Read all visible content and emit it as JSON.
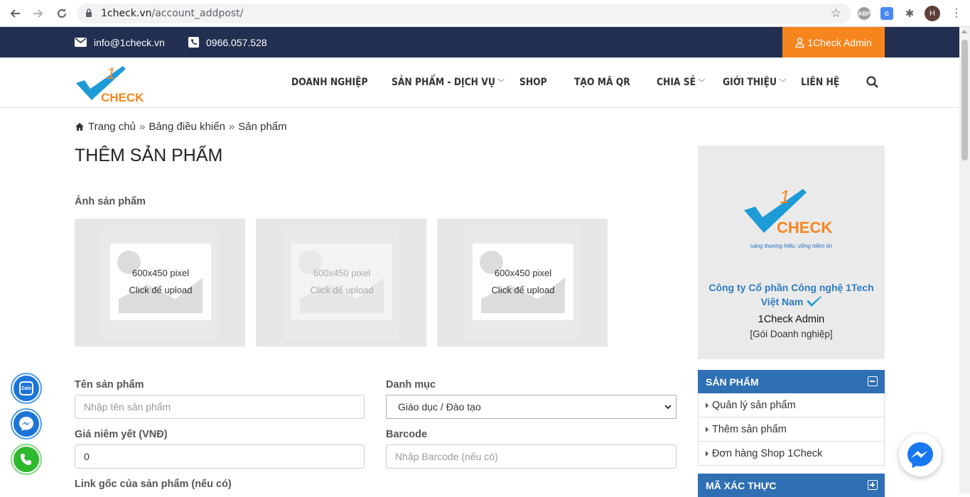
{
  "browser": {
    "url_domain": "1check.vn",
    "url_path": "/account_addpost/",
    "profile_initial": "H",
    "ext_abp": "ABP"
  },
  "topbar": {
    "email": "info@1check.vn",
    "phone": "0966.057.528",
    "admin_button": "1Check Admin"
  },
  "brand": {
    "logo_text": "CHECK",
    "logo_digit": "1"
  },
  "menu": [
    {
      "label": "DOANH NGHIỆP",
      "dropdown": false
    },
    {
      "label": "SẢN PHẨM - DỊCH VỤ",
      "dropdown": true
    },
    {
      "label": "SHOP",
      "dropdown": false
    },
    {
      "label": "TẠO MÃ QR",
      "dropdown": false
    },
    {
      "label": "CHIA SẺ",
      "dropdown": true
    },
    {
      "label": "GIỚI THIỆU",
      "dropdown": true
    },
    {
      "label": "LIÊN HỆ",
      "dropdown": false
    }
  ],
  "breadcrumb": {
    "home": "Trang chủ",
    "sep": "»",
    "dashboard": "Bảng điều khiển",
    "current": "Sản phẩm"
  },
  "page": {
    "title": "THÊM SẢN PHẨM",
    "images_label": "Ảnh sản phẩm",
    "upload_size": "600x450 pixel",
    "upload_hint": "Click để upload"
  },
  "form": {
    "name_label": "Tên sản phẩm",
    "name_placeholder": "Nhập tên sản phẩm",
    "category_label": "Danh mục",
    "category_value": "Giáo dục / Đào tạo",
    "price_label": "Giá niêm yết (VNĐ)",
    "price_value": "0",
    "barcode_label": "Barcode",
    "barcode_placeholder": "Nhập Barcode (nếu có)",
    "link_label": "Link gốc của sản phẩm (nếu có)"
  },
  "profile": {
    "tagline": "sáng thương hiệu, vững niềm tin",
    "company": "Công ty Cổ phần Công nghệ 1Tech Việt Nam",
    "username": "1Check Admin",
    "package": "[Gói Doanh nghiệp]"
  },
  "sidebar": {
    "products_header": "SẢN PHẨM",
    "products_items": [
      "Quản lý sản phẩm",
      "Thêm sản phẩm",
      "Đơn hàng Shop 1Check"
    ],
    "verify_header": "MÃ XÁC THỰC"
  },
  "floating": {
    "zalo_label": "Zalo"
  },
  "colors": {
    "topbar": "#222f50",
    "accent_orange": "#f7851e",
    "panel_blue": "#2f6fb3",
    "logo_blue": "#1d9bd7"
  }
}
